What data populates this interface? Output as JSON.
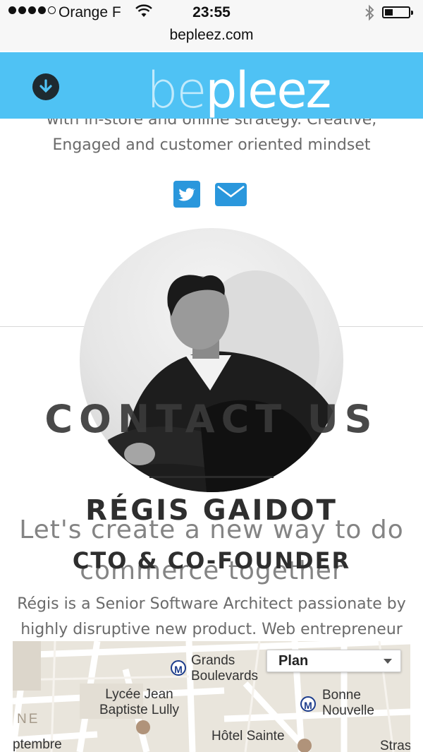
{
  "status_bar": {
    "carrier": "Orange F",
    "time": "23:55"
  },
  "browser": {
    "url": "bepleez.com"
  },
  "header": {
    "logo_be": "be",
    "logo_pleez": "pleez"
  },
  "profile_prev": {
    "bio_lines": [
      "with in-store and online strategy. Creative,",
      "Engaged and customer oriented mindset"
    ]
  },
  "contact": {
    "title": "CONTACT US",
    "subtitle_lines": [
      "Let's create a new way to do",
      "commerce together"
    ]
  },
  "profile": {
    "name": "RÉGIS GAIDOT",
    "role": "CTO & CO-FOUNDER",
    "bio_lines": [
      "Régis is a Senior Software Architect passionate by",
      "highly disruptive new product. Web entrepreneur"
    ]
  },
  "map": {
    "type_selected": "Plan",
    "labels": {
      "grands_boulevards": [
        "Grands",
        "Boulevards"
      ],
      "lycee": [
        "Lycée Jean",
        "Baptiste Lully"
      ],
      "bonne_nouvelle": [
        "Bonne",
        "Nouvelle"
      ],
      "hotel": "Hôtel Sainte",
      "septembre": "ptembre",
      "stras": "Stras",
      "ne": "NE",
      "metro_letter": "M"
    }
  },
  "colors": {
    "header_bg": "#4fc2f4",
    "social_blue": "#2a97dc",
    "metro_blue": "#1c3c8c"
  }
}
